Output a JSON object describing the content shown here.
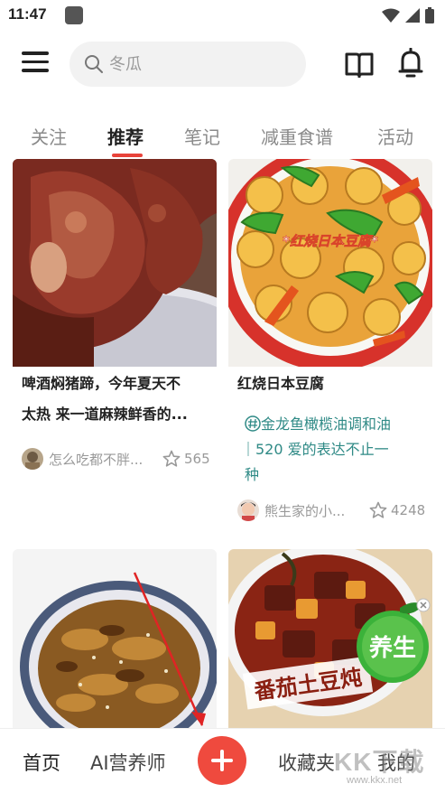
{
  "status_bar": {
    "time": "11:47"
  },
  "search": {
    "placeholder": "冬瓜"
  },
  "tabs": [
    {
      "label": "关注"
    },
    {
      "label": "推荐",
      "active": true
    },
    {
      "label": "笔记"
    },
    {
      "label": "减重食谱"
    },
    {
      "label": "活动"
    }
  ],
  "feed": [
    {
      "title_line1": "啤酒焖猪蹄，今年夏天不",
      "title_line2": "太热 来一道麻辣鲜香的...",
      "author": "怎么吃都不胖...",
      "likes": "565"
    },
    {
      "title_line1": "红烧日本豆腐",
      "image_caption": "*红烧日本豆腐*",
      "topic_line1": "金龙鱼橄榄油调和油",
      "topic_line2": "｜520 爱的表达不止一",
      "topic_line3": "种",
      "author": "熊生家的小...",
      "likes": "4248"
    },
    {
      "title_line1": ""
    },
    {
      "image_caption": "番茄土豆炖",
      "badge": "养生"
    }
  ],
  "bottom_nav": [
    {
      "label": "首页",
      "active": true
    },
    {
      "label": "AI营养师"
    },
    {
      "label": "收藏夹"
    },
    {
      "label": "我的"
    }
  ],
  "watermark": {
    "text": "KK下载",
    "url": "www.kkx.net"
  },
  "colors": {
    "accent": "#e8433a",
    "topic": "#2f8a86",
    "add_button": "#ef4a3e"
  }
}
